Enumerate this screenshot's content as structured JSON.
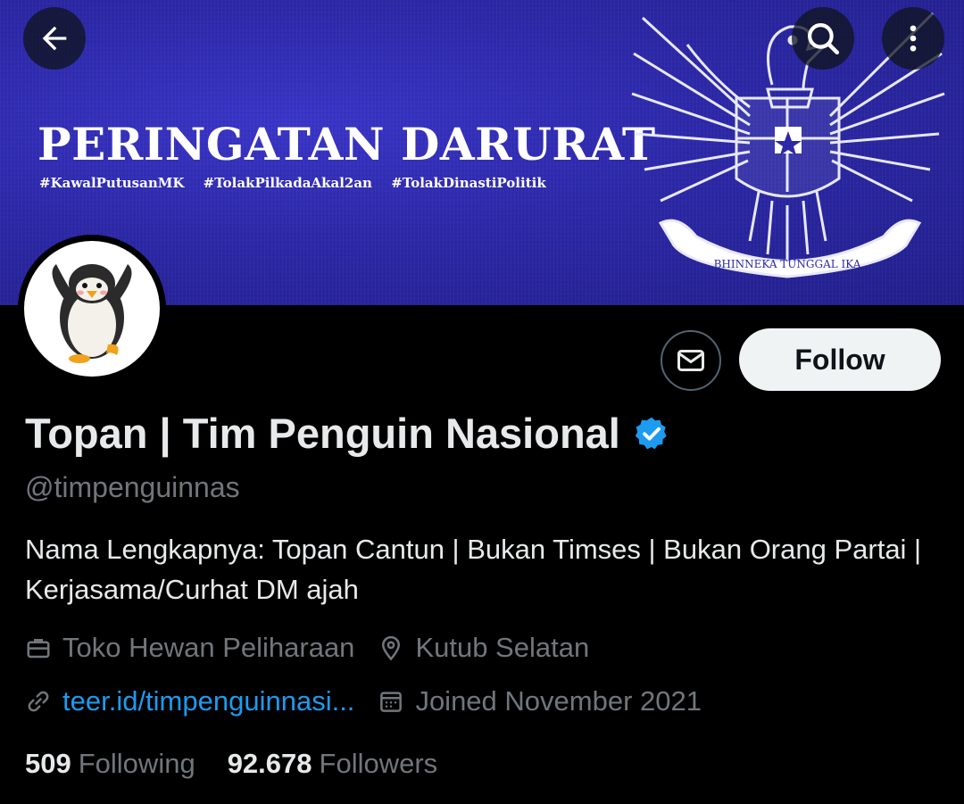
{
  "banner": {
    "title": "PERINGATAN DARURAT",
    "hashtags": [
      "#KawalPutusanMK",
      "#TolakPilkadaAkal2an",
      "#TolakDinastiPolitik"
    ],
    "emblem_motto": "BHINNEKA TUNGGAL IKA",
    "background_color": "#2c28a8"
  },
  "nav": {
    "back_icon": "arrow-left-icon",
    "search_icon": "search-icon",
    "more_icon": "more-vertical-icon"
  },
  "actions": {
    "message_icon": "envelope-icon",
    "follow_label": "Follow"
  },
  "profile": {
    "name": "Topan | Tim Penguin Nasional",
    "verified": true,
    "handle": "@timpenguinnas",
    "bio": "Nama Lengkapnya: Topan Cantun | Bukan Timses | Bukan Orang Partai | Kerjasama/Curhat DM ajah",
    "category": "Toko Hewan Peliharaan",
    "location": "Kutub Selatan",
    "website": "teer.id/timpenguinnasi...",
    "joined": "Joined November 2021"
  },
  "stats": {
    "following_count": "509",
    "following_label": "Following",
    "followers_count": "92.678",
    "followers_label": "Followers"
  },
  "colors": {
    "accent": "#1d9bf0",
    "muted": "#71767b",
    "text": "#e7e9ea",
    "follow_bg": "#eff3f4"
  }
}
